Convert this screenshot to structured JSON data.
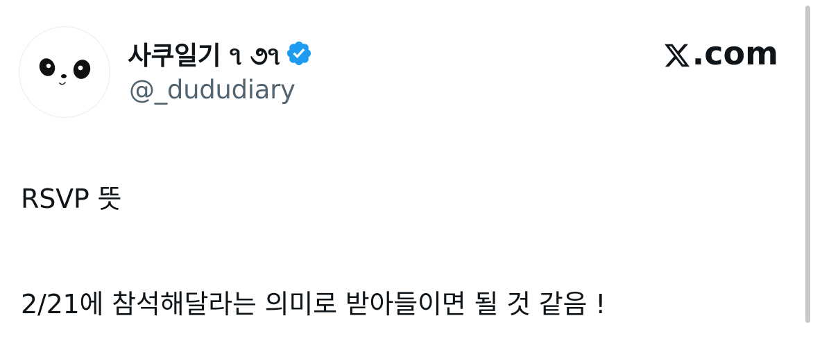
{
  "author": {
    "display_name": "사쿠일기 ૧ ૭૧",
    "handle": "@_dududiary",
    "verified": true,
    "avatar_icon": "panda-face-icon",
    "verified_color": "#1d9bf0"
  },
  "brand": {
    "label": ".com",
    "icon": "x-logo-icon"
  },
  "tweet": {
    "line_1": "RSVP 뜻",
    "line_2": "2/21에 참석해달라는 의미로 받아들이면 될 것 같음 !"
  },
  "colors": {
    "text": "#0f1419",
    "handle": "#536471",
    "verified": "#1d9bf0"
  }
}
